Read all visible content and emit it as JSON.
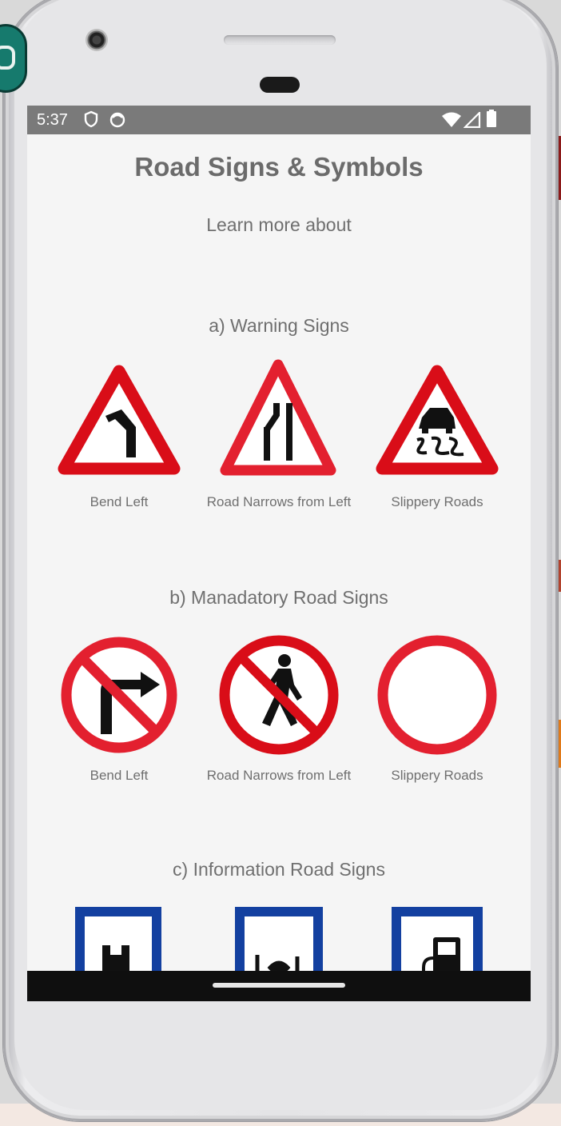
{
  "colors": {
    "warning_red": "#d90d18",
    "mandatory_red": "#e3202f",
    "info_blue": "#1340a0",
    "text_gray": "#6f6f6f",
    "title_gray": "#6b6b6b",
    "statusbar_gray": "#7a7a7a"
  },
  "statusbar": {
    "time": "5:37",
    "icons": [
      "shield-icon",
      "face-icon",
      "wifi-icon",
      "signal-icon",
      "battery-icon"
    ]
  },
  "header": {
    "title": "Road Signs & Symbols",
    "subtitle": "Learn more about"
  },
  "sections": [
    {
      "title": "a) Warning Signs",
      "items": [
        {
          "label": "Bend Left",
          "icon": "bend-left-warning-sign-icon"
        },
        {
          "label": "Road Narrows from Left",
          "icon": "road-narrows-sign-icon"
        },
        {
          "label": "Slippery Roads",
          "icon": "slippery-road-sign-icon"
        }
      ]
    },
    {
      "title": "b) Manadatory Road Signs",
      "items": [
        {
          "label": "Bend Left",
          "icon": "no-right-turn-sign-icon"
        },
        {
          "label": "Road Narrows from Left",
          "icon": "no-pedestrians-sign-icon"
        },
        {
          "label": "Slippery Roads",
          "icon": "no-vehicles-sign-icon"
        }
      ]
    },
    {
      "title": "c) Information Road Signs",
      "items": [
        {
          "icon": "hospital-info-sign-icon"
        },
        {
          "icon": "restaurant-info-sign-icon"
        },
        {
          "icon": "fuel-station-info-sign-icon"
        }
      ]
    }
  ]
}
